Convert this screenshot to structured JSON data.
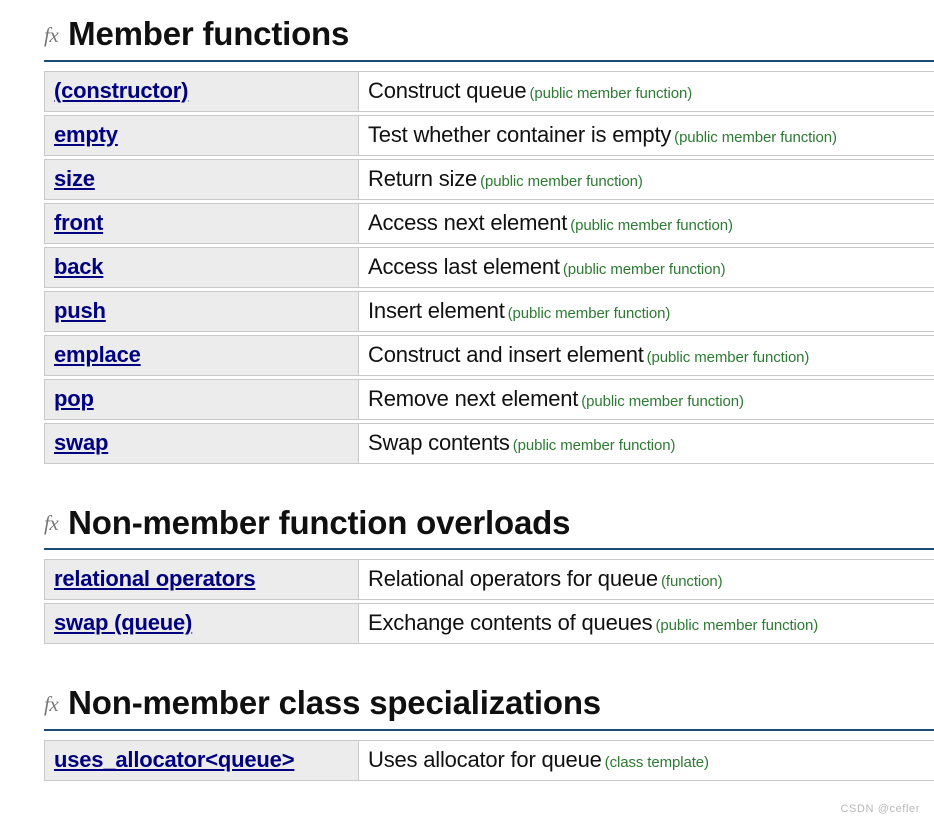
{
  "icons": {
    "section_icon": "fx"
  },
  "sections": [
    {
      "icon_label": "fx",
      "title": "Member functions",
      "rows": [
        {
          "name": "(constructor)",
          "desc": "Construct queue",
          "kind": "(public member function)"
        },
        {
          "name": "empty",
          "desc": "Test whether container is empty",
          "kind": "(public member function)"
        },
        {
          "name": "size",
          "desc": "Return size",
          "kind": "(public member function)"
        },
        {
          "name": "front",
          "desc": "Access next element",
          "kind": "(public member function)"
        },
        {
          "name": "back",
          "desc": "Access last element",
          "kind": "(public member function)"
        },
        {
          "name": "push",
          "desc": "Insert element",
          "kind": "(public member function)"
        },
        {
          "name": "emplace",
          "desc": "Construct and insert element",
          "kind": "(public member function)"
        },
        {
          "name": "pop",
          "desc": "Remove next element",
          "kind": "(public member function)"
        },
        {
          "name": "swap",
          "desc": "Swap contents",
          "kind": "(public member function)"
        }
      ]
    },
    {
      "icon_label": "fx",
      "title": "Non-member function overloads",
      "rows": [
        {
          "name": "relational operators",
          "desc": "Relational operators for queue",
          "kind": "(function)"
        },
        {
          "name": "swap (queue)",
          "desc": "Exchange contents of queues",
          "kind": "(public member function)"
        }
      ]
    },
    {
      "icon_label": "fx",
      "title": "Non-member class specializations",
      "rows": [
        {
          "name": "uses_allocator<queue>",
          "desc": "Uses allocator for queue",
          "kind": "(class template)"
        }
      ]
    }
  ],
  "watermark": "CSDN @cefler",
  "colors": {
    "link": "#000080",
    "kind": "#2d7a33",
    "rule": "#1e4a7a",
    "cell_bg": "#ececec",
    "border": "#c9c9c9"
  }
}
